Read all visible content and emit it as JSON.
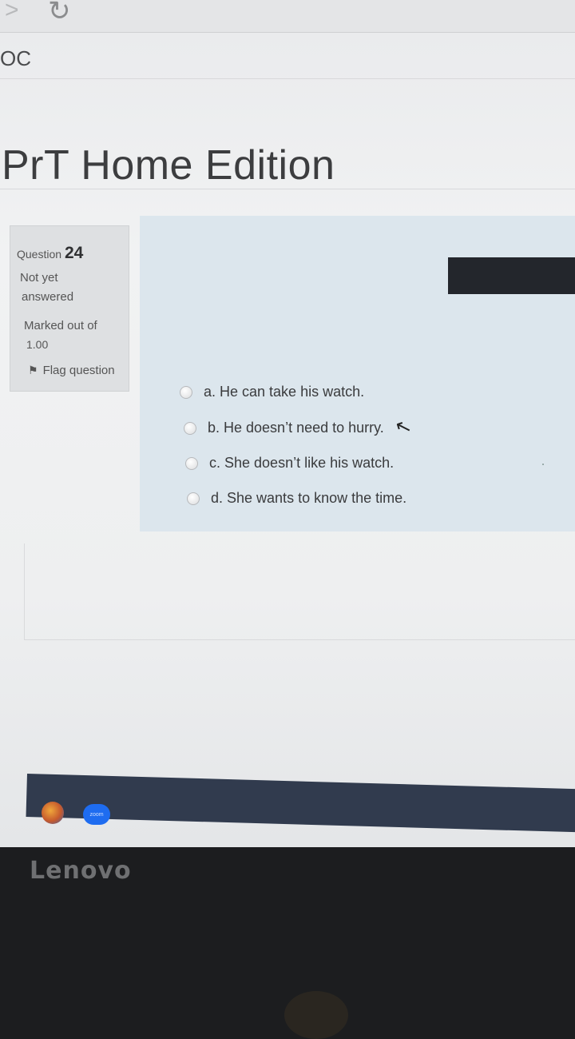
{
  "browser": {
    "forward_icon": "chevron-right-icon",
    "reload_icon": "reload-icon",
    "tab_fragment": "OC"
  },
  "site": {
    "title": "PrT Home Edition"
  },
  "question_info": {
    "label": "Question",
    "number": "24",
    "state_line1": "Not yet",
    "state_line2": "answered",
    "marked_line1": "Marked out of",
    "marked_line2": "1.00",
    "flag_label": "Flag question"
  },
  "options": [
    {
      "label": "a. He can take his watch."
    },
    {
      "label": "b. He doesn’t need to hurry."
    },
    {
      "label": "c. She doesn’t like his watch."
    },
    {
      "label": "d. She wants to know the time."
    }
  ],
  "taskbar": {
    "app2_label": "zoom"
  },
  "device": {
    "brand": "Lenovo"
  },
  "colors": {
    "question_bg": "#dce6ed",
    "info_bg": "#dee0e2",
    "taskbar": "#313b4e"
  }
}
